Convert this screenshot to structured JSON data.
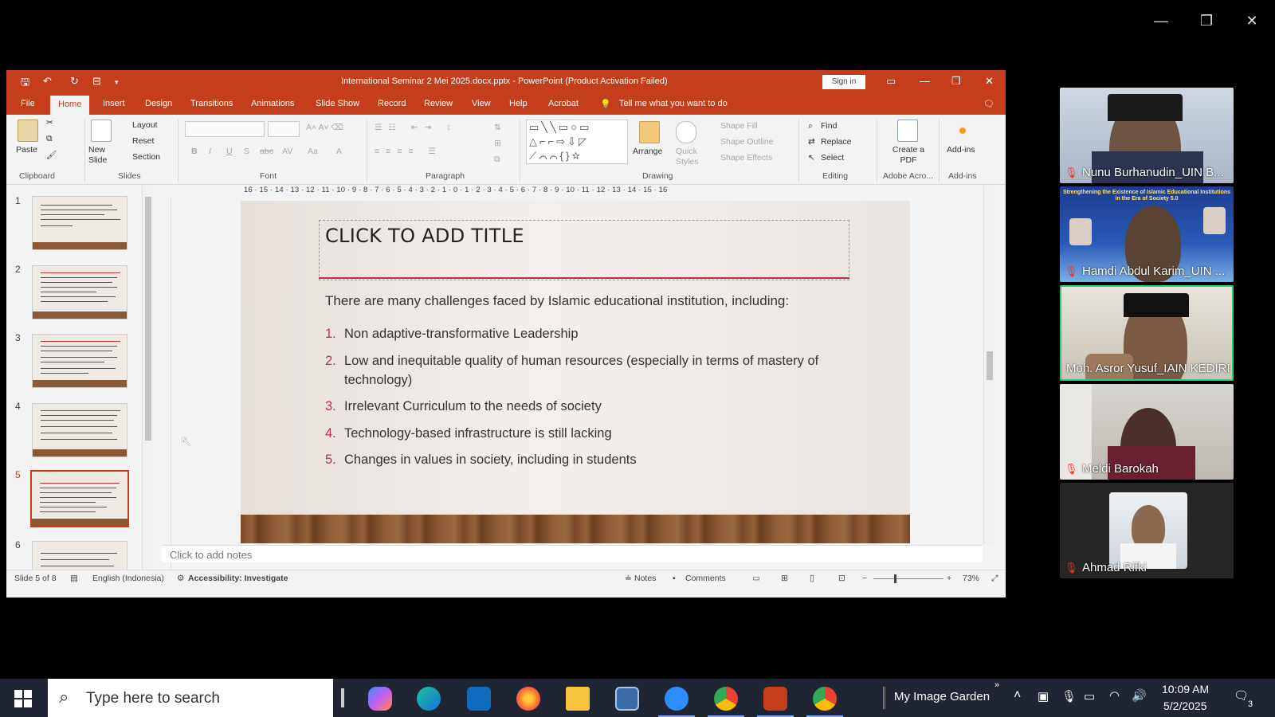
{
  "ppt": {
    "window_title": "International Seminar 2 Mei 2025.docx.pptx  -  PowerPoint (Product Activation Failed)",
    "sign_in": "Sign in",
    "tabs": [
      "File",
      "Home",
      "Insert",
      "Design",
      "Transitions",
      "Animations",
      "Slide Show",
      "Record",
      "Review",
      "View",
      "Help",
      "Acrobat"
    ],
    "tell_me": "Tell me what you want to do",
    "ribbon": {
      "clipboard": {
        "paste": "Paste",
        "label": "Clipboard"
      },
      "slides": {
        "new_slide": "New Slide",
        "layout": "Layout",
        "reset": "Reset",
        "section": "Section",
        "label": "Slides"
      },
      "font": {
        "label": "Font"
      },
      "paragraph": {
        "label": "Paragraph"
      },
      "drawing": {
        "arrange": "Arrange",
        "quick_styles": "Quick Styles",
        "shape_fill": "Shape Fill",
        "shape_outline": "Shape Outline",
        "shape_effects": "Shape Effects",
        "label": "Drawing"
      },
      "editing": {
        "find": "Find",
        "replace": "Replace",
        "select": "Select",
        "label": "Editing"
      },
      "adobe": {
        "create_pdf": "Create a PDF",
        "label": "Adobe Acro..."
      },
      "addins": {
        "addins": "Add-ins",
        "label": "Add-ins"
      }
    },
    "thumbnails": [
      "1",
      "2",
      "3",
      "4",
      "5",
      "6"
    ],
    "active_slide": 5,
    "ruler_numbers": "16 · 15 · 14 · 13 · 12 · 11 · 10 · 9 · 8 · 7 · 6 · 5 · 4 · 3 · 2 · 1 · 0 · 1 · 2 · 3 · 4 · 5 · 6 · 7 · 8 · 9 · 10 · 11 · 12 · 13 · 14 · 15 · 16",
    "slide": {
      "title_placeholder": "CLICK TO ADD TITLE",
      "intro": "There are many challenges faced by Islamic educational institution, including:",
      "items": [
        {
          "num": "1.",
          "text": "Non adaptive-transformative  Leadership"
        },
        {
          "num": "2.",
          "text": "Low and inequitable quality of human resources (especially in terms of mastery of technology)"
        },
        {
          "num": "3.",
          "text": "Irrelevant  Curriculum to the needs of society"
        },
        {
          "num": "4.",
          "text": "Technology-based  infrastructure  is still lacking"
        },
        {
          "num": "5.",
          "text": "Changes in values in society, including in students"
        }
      ]
    },
    "notes_placeholder": "Click to add notes",
    "status": {
      "slide_of": "Slide 5 of 8",
      "language": "English (Indonesia)",
      "accessibility": "Accessibility: Investigate",
      "notes": "Notes",
      "comments": "Comments",
      "zoom": "73%"
    }
  },
  "participants": [
    {
      "name": "Nunu Burhanudin_UIN B...",
      "muted": true
    },
    {
      "name": "Hamdi Abdul Karim_UIN ...",
      "muted": true
    },
    {
      "name": "Moh. Asror Yusuf_IAIN KEDIRI",
      "muted": false,
      "active_speaker": true
    },
    {
      "name": "Meldi Barokah",
      "muted": true
    },
    {
      "name": "Ahmad Rifki",
      "muted": true
    }
  ],
  "taskbar": {
    "search_placeholder": "Type here to search",
    "app_label": "My Image Garden",
    "time": "10:09 AM",
    "date": "5/2/2025",
    "notification_count": "3"
  },
  "colors": {
    "ppt_accent": "#c43e1c",
    "slide_accent": "#c0304a",
    "active_speaker_border": "#2ecc71",
    "taskbar": "#1f2533"
  }
}
